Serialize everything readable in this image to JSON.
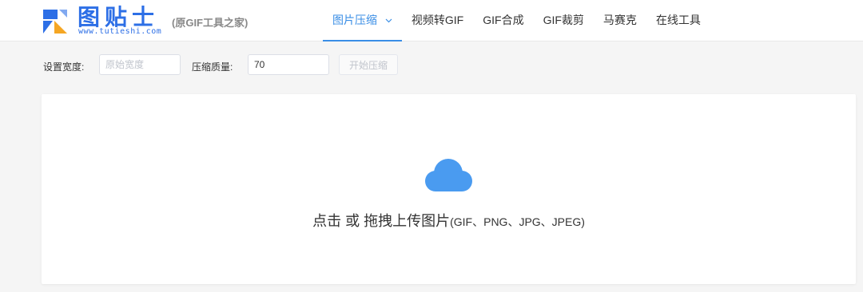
{
  "header": {
    "logo": {
      "title": "图贴士",
      "url": "www.tutieshi.com",
      "tagline": "(原GIF工具之家)"
    },
    "nav": [
      {
        "label": "图片压缩",
        "active": true,
        "has_dropdown": true
      },
      {
        "label": "视频转GIF"
      },
      {
        "label": "GIF合成"
      },
      {
        "label": "GIF裁剪"
      },
      {
        "label": "马赛克"
      },
      {
        "label": "在线工具"
      }
    ]
  },
  "toolbar": {
    "width_label": "设置宽度:",
    "width_placeholder": "原始宽度",
    "quality_label": "压缩质量:",
    "quality_value": "70",
    "start_button": "开始压缩"
  },
  "upload": {
    "icon": "cloud-icon",
    "text_main": "点击 或 拖拽上传图片",
    "text_formats": "(GIF、PNG、JPG、JPEG)"
  },
  "colors": {
    "accent": "#3a8ee6",
    "cloud": "#4a9bf0",
    "logo": "#2d6fe6"
  }
}
